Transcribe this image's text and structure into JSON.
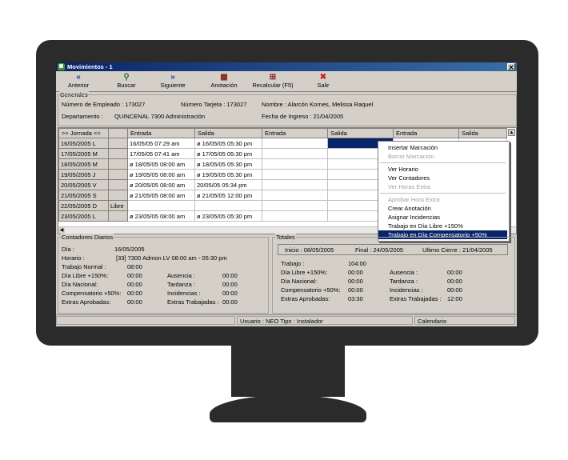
{
  "window": {
    "title": "Movimientos    - 1",
    "app_icon": "app-icon",
    "close": "✕"
  },
  "toolbar": {
    "items": [
      {
        "label": "Anterior",
        "icon": "«",
        "color": "#1a3fa8"
      },
      {
        "label": "Buscar",
        "icon": "⚲",
        "color": "#2d6a2d"
      },
      {
        "label": "Siguiente",
        "icon": "»",
        "color": "#1a3fa8"
      },
      {
        "label": "Anotación",
        "icon": "▦",
        "color": "#8a2020"
      },
      {
        "label": "Recalcular (F5)",
        "icon": "⊞",
        "color": "#8a2020"
      },
      {
        "label": "Salir",
        "icon": "✖",
        "color": "#d02020"
      }
    ]
  },
  "generales": {
    "legend": "Generales",
    "empleado": "Número de Empleado : 173027",
    "tarjeta": "Número Tarjeta : 173027",
    "nombre": "Nombre : Alarcón Kornes, Melissa Raquel",
    "departamento_label": "Departamento :",
    "departamento_value": "QUINCENAL 7300 Administración",
    "fecha_ingreso": "Fecha de Ingreso : 21/04/2005"
  },
  "grid": {
    "headers": [
      ">> Jornada <<",
      "",
      "Entrada",
      "Salida",
      "Entrada",
      "Salida",
      "Entrada",
      "Salida"
    ],
    "rows": [
      {
        "date": "16/05/2005",
        "day": "L",
        "note": "",
        "e1": "16/05/05 07:29 am",
        "s1": "ø 16/05/05 05:30 pm",
        "sel": true
      },
      {
        "date": "17/05/2005",
        "day": "M",
        "note": "",
        "e1": "17/05/05 07:41 am",
        "s1": "ø 17/05/05 05:30 pm",
        "sel": false
      },
      {
        "date": "18/05/2005",
        "day": "M",
        "note": "",
        "e1": "ø 18/05/05 08:00 am",
        "s1": "ø 18/05/05 05:30 pm",
        "sel": false
      },
      {
        "date": "19/05/2005",
        "day": "J",
        "note": "",
        "e1": "ø 19/05/05 08:00 am",
        "s1": "ø 19/05/05 05:30 pm",
        "sel": false
      },
      {
        "date": "20/05/2005",
        "day": "V",
        "note": "",
        "e1": "ø 20/05/05 08:00 am",
        "s1": "20/05/05 05:34 pm",
        "sel": false
      },
      {
        "date": "21/05/2005",
        "day": "S",
        "note": "",
        "e1": "ø 21/05/05 08:00 am",
        "s1": "ø 21/05/05 12:00 pm",
        "sel": false
      },
      {
        "date": "22/05/2005",
        "day": "D",
        "note": "Libre",
        "e1": "",
        "s1": "",
        "sel": false
      },
      {
        "date": "23/05/2005",
        "day": "L",
        "note": "",
        "e1": "ø 23/05/05 08:00 am",
        "s1": "ø 23/05/05 05:30 pm",
        "sel": false
      }
    ]
  },
  "context_menu": [
    {
      "label": "Insertar Marcación",
      "state": "normal"
    },
    {
      "label": "Borrar Marcación",
      "state": "disabled"
    },
    {
      "label": "Ver Horario",
      "state": "normal"
    },
    {
      "label": "Ver Contadores",
      "state": "normal"
    },
    {
      "label": "Ver Horas Extra",
      "state": "disabled"
    },
    {
      "label": "Aprobar Hora Extra",
      "state": "disabled"
    },
    {
      "label": "Crear Anotación",
      "state": "normal"
    },
    {
      "label": "Asignar Incidencias",
      "state": "normal"
    },
    {
      "label": "Trabajo en Día Libre +150%",
      "state": "normal"
    },
    {
      "label": "Trabajo en Día Compensatorio +50%",
      "state": "highlighted"
    }
  ],
  "contadores": {
    "legend": "Contadores Diarios",
    "dia_label": "Día :",
    "dia_value": "16/05/2005",
    "horario_label": "Horario :",
    "horario_value": "[33]  7300 Admon LV  08:00 am - 05:30 pm",
    "normal_label": "Trabajo Normal :",
    "normal_value": "08:00",
    "libre_label": "Día Libre +150%:",
    "libre_value": "00:00",
    "nacional_label": "Día Nacional:",
    "nacional_value": "00:00",
    "comp_label": "Compensatorio +50%:",
    "comp_value": "00:00",
    "extras_label": "Extras Aprobadas:",
    "extras_value": "00:00",
    "ausencia_label": "Ausencia :",
    "ausencia_value": "00:00",
    "tardanza_label": "Tardanza :",
    "tardanza_value": "00:00",
    "incid_label": "Incidencias :",
    "incid_value": "00:00",
    "trab_label": "Extras Trabajadas :",
    "trab_value": "00:00"
  },
  "totales": {
    "legend": "Totales",
    "inicio": "Inicio :  08/05/2005",
    "final": "Final :  24/05/2005",
    "cierre": "Ultimo Cierre :  21/04/2005",
    "trabajo_label": "Trabajo :",
    "trabajo_value": "104:00",
    "libre_label": "Día Libre +150%:",
    "libre_value": "00:00",
    "nacional_label": "Día Nacional:",
    "nacional_value": "00:00",
    "comp_label": "Compensatorio +50%:",
    "comp_value": "00:00",
    "extras_label": "Extras Aprobadas:",
    "extras_value": "03:30",
    "ausencia_label": "Ausencia :",
    "ausencia_value": "00:00",
    "tardanza_label": "Tardanza :",
    "tardanza_value": "00:00",
    "incid_label": "Incidencias :",
    "incid_value": "00:00",
    "trab_label": "Extras Trabajadas :",
    "trab_value": "12:00"
  },
  "status": {
    "usuario": "Usuario : NEO Tipo : Instalador",
    "calendario": "Calendario"
  }
}
